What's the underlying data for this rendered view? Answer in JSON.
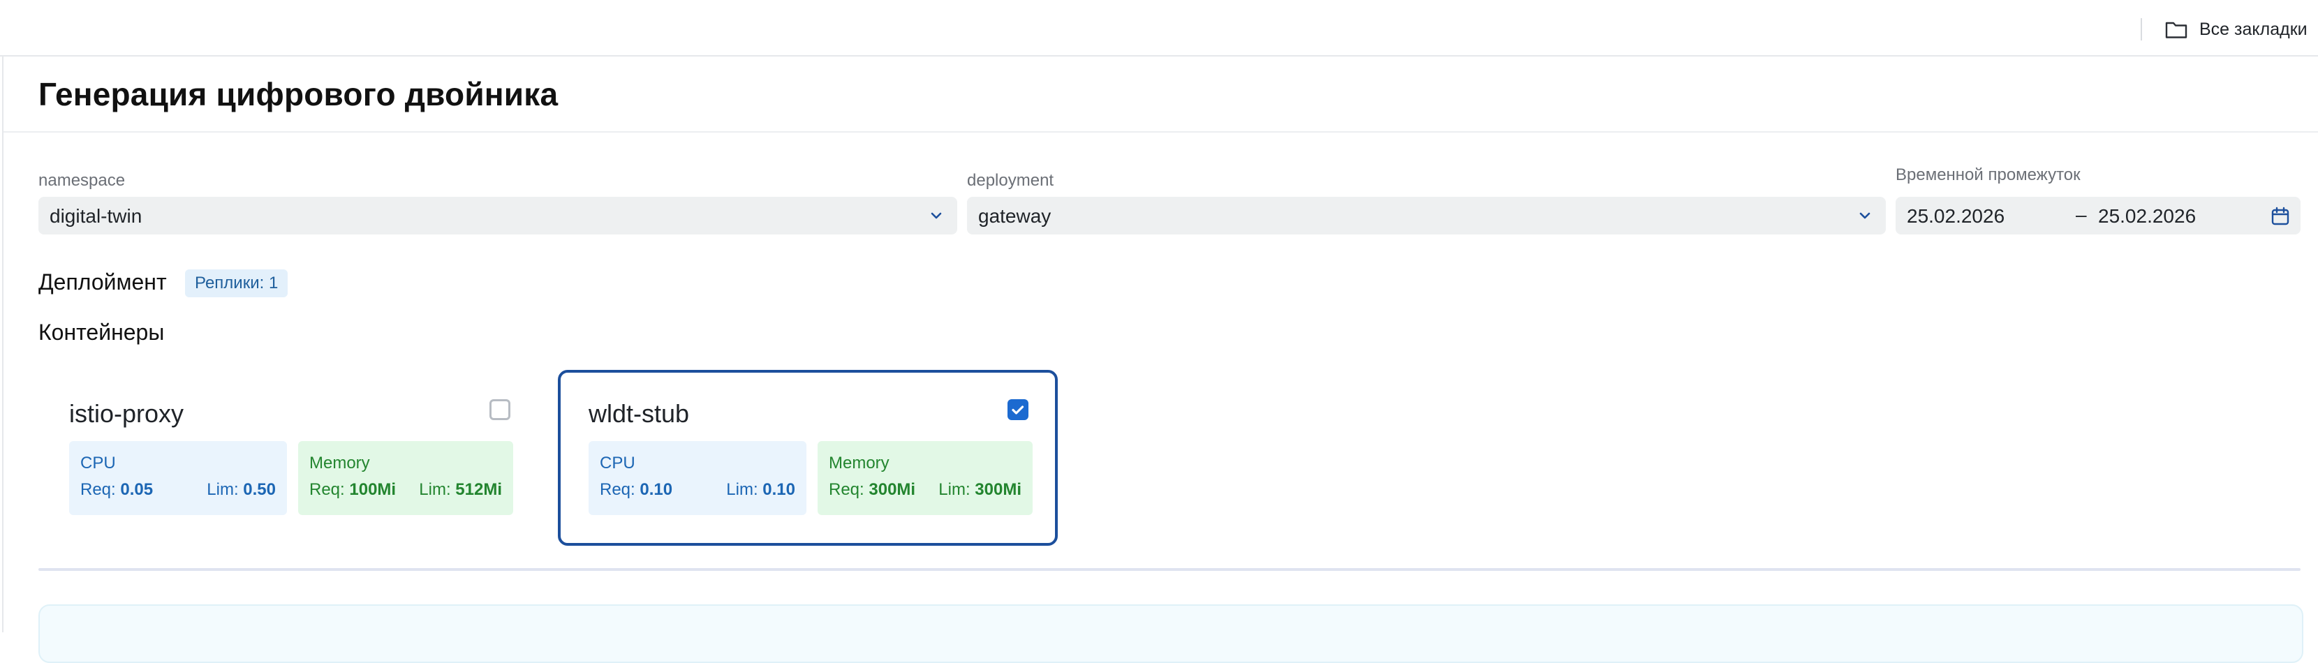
{
  "topbar": {
    "bookmarks_label": "Все закладки",
    "bookmarks_icon": "folder-icon"
  },
  "page": {
    "title": "Генерация цифрового двойника"
  },
  "filters": {
    "namespace": {
      "label": "namespace",
      "value": "digital-twin"
    },
    "deployment": {
      "label": "deployment",
      "value": "gateway"
    },
    "period": {
      "label": "Временной промежуток",
      "from": "25.02.2026",
      "separator": "–",
      "to": "25.02.2026",
      "icon": "calendar-icon"
    }
  },
  "deployment_section": {
    "heading": "Деплоймент",
    "replicas_badge": "Реплики: 1"
  },
  "containers_section": {
    "heading": "Контейнеры",
    "cards": [
      {
        "name": "istio-proxy",
        "selected": false,
        "cpu": {
          "label": "CPU",
          "req_label": "Req:",
          "req": "0.05",
          "lim_label": "Lim:",
          "lim": "0.50"
        },
        "memory": {
          "label": "Memory",
          "req_label": "Req:",
          "req": "100Mi",
          "lim_label": "Lim:",
          "lim": "512Mi"
        }
      },
      {
        "name": "wldt-stub",
        "selected": true,
        "cpu": {
          "label": "CPU",
          "req_label": "Req:",
          "req": "0.10",
          "lim_label": "Lim:",
          "lim": "0.10"
        },
        "memory": {
          "label": "Memory",
          "req_label": "Req:",
          "req": "300Mi",
          "lim_label": "Lim:",
          "lim": "300Mi"
        }
      }
    ]
  },
  "colors": {
    "accent": "#1c4f9c",
    "checkbox_checked": "#1c6ad0",
    "cpu_text": "#1c66b4",
    "cpu_bg": "#eaf4fd",
    "memory_text": "#23852f",
    "memory_bg": "#e2f8e6",
    "badge_bg": "#e3f0fb"
  }
}
